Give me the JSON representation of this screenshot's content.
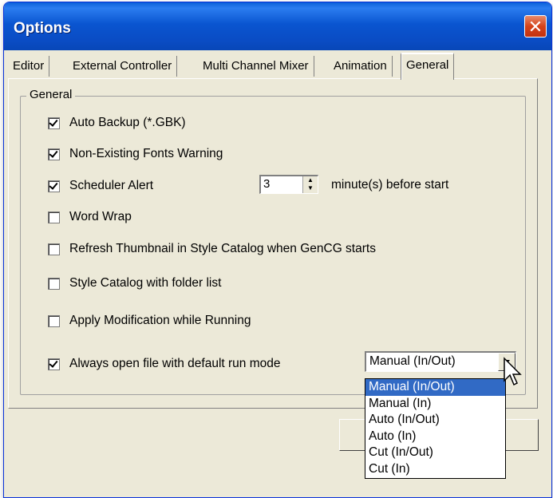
{
  "window": {
    "title": "Options",
    "close_glyph": "✕"
  },
  "tabs": [
    {
      "label": "Editor"
    },
    {
      "label": "External Controller"
    },
    {
      "label": "Multi Channel Mixer"
    },
    {
      "label": "Animation"
    },
    {
      "label": "General",
      "active": true
    }
  ],
  "group": {
    "label": "General",
    "options": [
      {
        "label": "Auto Backup (*.GBK)",
        "checked": true
      },
      {
        "label": "Non-Existing Fonts Warning",
        "checked": true
      },
      {
        "label": "Scheduler Alert",
        "checked": true
      },
      {
        "label": "Word Wrap",
        "checked": false
      },
      {
        "label": "Refresh Thumbnail in Style Catalog when GenCG starts",
        "checked": false
      },
      {
        "label": "Style Catalog with folder list",
        "checked": false
      },
      {
        "label": "Apply Modification while Running",
        "checked": false
      },
      {
        "label": "Always open file with default run mode",
        "checked": true
      }
    ]
  },
  "scheduler": {
    "minutes_value": "3",
    "suffix": "minute(s) before start"
  },
  "run_mode": {
    "selected": "Manual (In/Out)",
    "options": [
      "Manual (In/Out)",
      "Manual (In)",
      "Auto (In/Out)",
      "Auto (In)",
      "Cut (In/Out)",
      "Cut (In)"
    ],
    "highlighted_index": 0
  },
  "colors": {
    "titlebar": "#0a55d0",
    "selection": "#316ac5",
    "face": "#ece9d8"
  }
}
